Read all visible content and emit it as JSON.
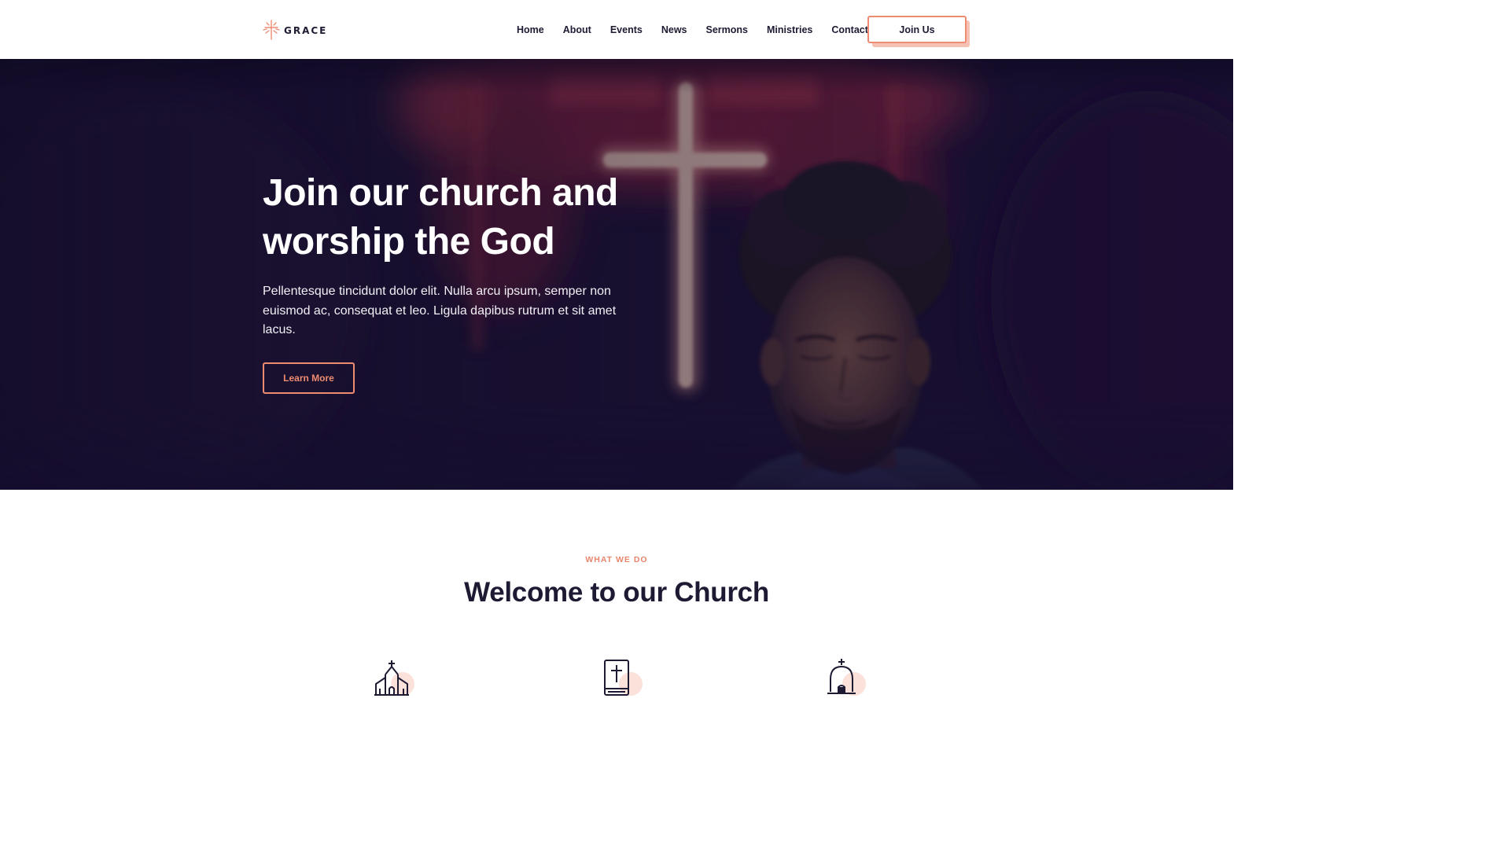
{
  "brand": {
    "name": "GRACE",
    "accent_color": "#ee8c72",
    "dark_color": "#1f1a33"
  },
  "nav": {
    "items": [
      {
        "label": "Home"
      },
      {
        "label": "About"
      },
      {
        "label": "Events"
      },
      {
        "label": "News"
      },
      {
        "label": "Sermons"
      },
      {
        "label": "Ministries"
      },
      {
        "label": "Contact"
      }
    ],
    "cta_label": "Join Us"
  },
  "hero": {
    "title_line1": "Join our church and",
    "title_line2": "worship the God",
    "text": "Pellentesque tincidunt dolor elit. Nulla arcu ipsum, semper non euismod ac, consequat et leo. Ligula dapibus rutrum et sit amet lacus.",
    "button_label": "Learn More",
    "background": "photo-man-praying-with-glowing-cross",
    "overlay_color": "#170f2f"
  },
  "welcome": {
    "eyebrow": "WHAT WE DO",
    "title": "Welcome to our Church",
    "features": [
      {
        "icon": "church-icon"
      },
      {
        "icon": "bible-icon"
      },
      {
        "icon": "chapel-bell-icon"
      }
    ]
  }
}
